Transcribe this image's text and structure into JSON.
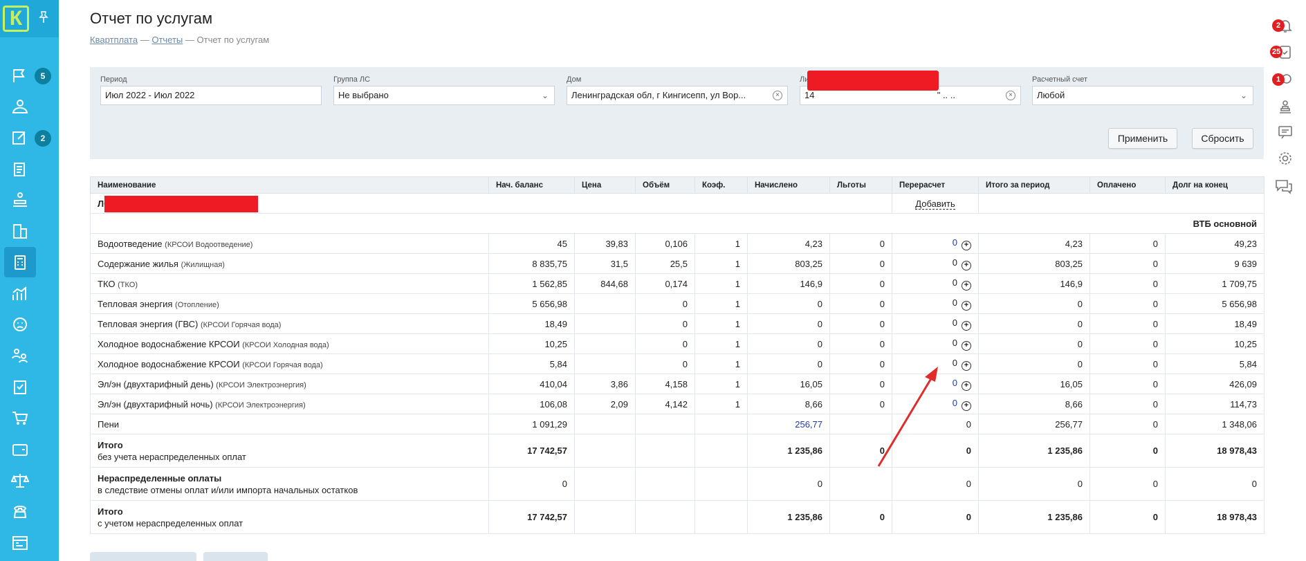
{
  "header": {
    "title": "Отчет по услугам",
    "breadcrumb": [
      "Квартплата",
      "Отчеты",
      "Отчет по услугам"
    ],
    "separator": "—"
  },
  "sidebar": {
    "logo": "К",
    "items": [
      {
        "icon": "flag-icon",
        "badge": "5"
      },
      {
        "icon": "users-group-icon"
      },
      {
        "icon": "edit-document-icon",
        "badge": "2"
      },
      {
        "icon": "documents-icon"
      },
      {
        "icon": "desk-icon"
      },
      {
        "icon": "building-icon"
      },
      {
        "icon": "calculator-icon",
        "active": true
      },
      {
        "icon": "chart-icon"
      },
      {
        "icon": "face-icon"
      },
      {
        "icon": "team-icon"
      },
      {
        "icon": "checklist-icon"
      },
      {
        "icon": "cart-icon"
      },
      {
        "icon": "wallet-icon"
      },
      {
        "icon": "scales-icon"
      },
      {
        "icon": "phone-icon"
      },
      {
        "icon": "calendar-icon"
      }
    ]
  },
  "rail": {
    "notifications_badge": "2",
    "tasks_badge": "25",
    "requests_badge": "1"
  },
  "filters": {
    "period": {
      "label": "Период",
      "value": "Июл 2022 - Июл 2022"
    },
    "group": {
      "label": "Группа ЛС",
      "value": "Не выбрано"
    },
    "house": {
      "label": "Дом",
      "value": "Ленинградская обл, г Кингисепп, ул Вор..."
    },
    "account": {
      "label": "Лицевой счет",
      "value_prefix": "14",
      "value_suffix": "\" .. .."
    },
    "settlement": {
      "label": "Расчетный счет",
      "value": "Любой"
    },
    "apply_label": "Применить",
    "reset_label": "Сбросить"
  },
  "table": {
    "columns": [
      "Наименование",
      "Нач. баланс",
      "Цена",
      "Объём",
      "Коэф.",
      "Начислено",
      "Льготы",
      "Перерасчет",
      "Итого за период",
      "Оплачено",
      "Долг на конец"
    ],
    "account_row": {
      "prefix": "ЛС",
      "add_label": "Добавить"
    },
    "section_title": "ВТБ основной",
    "rows": [
      {
        "name": "Водоотведение",
        "sub": "(КРСОИ Водоотведение)",
        "start": "45",
        "price": "39,83",
        "volume": "0,106",
        "coef": "1",
        "charged": "4,23",
        "benefits": "0",
        "recalc": "0",
        "recalc_blue": true,
        "total": "4,23",
        "paid": "0",
        "debt": "49,23"
      },
      {
        "name": "Содержание жилья",
        "sub": "(Жилищная)",
        "start": "8 835,75",
        "price": "31,5",
        "volume": "25,5",
        "coef": "1",
        "charged": "803,25",
        "benefits": "0",
        "recalc": "0",
        "recalc_blue": false,
        "total": "803,25",
        "paid": "0",
        "debt": "9 639"
      },
      {
        "name": "ТКО",
        "sub": "(ТКО)",
        "start": "1 562,85",
        "price": "844,68",
        "volume": "0,174",
        "coef": "1",
        "charged": "146,9",
        "benefits": "0",
        "recalc": "0",
        "recalc_blue": false,
        "total": "146,9",
        "paid": "0",
        "debt": "1 709,75"
      },
      {
        "name": "Тепловая энергия",
        "sub": "(Отопление)",
        "start": "5 656,98",
        "price": "",
        "volume": "0",
        "coef": "1",
        "charged": "0",
        "benefits": "0",
        "recalc": "0",
        "recalc_blue": false,
        "total": "0",
        "paid": "0",
        "debt": "5 656,98"
      },
      {
        "name": "Тепловая энергия (ГВС)",
        "sub": "(КРСОИ Горячая вода)",
        "start": "18,49",
        "price": "",
        "volume": "0",
        "coef": "1",
        "charged": "0",
        "benefits": "0",
        "recalc": "0",
        "recalc_blue": false,
        "total": "0",
        "paid": "0",
        "debt": "18,49"
      },
      {
        "name": "Холодное водоснабжение КРСОИ",
        "sub": "(КРСОИ Холодная вода)",
        "start": "10,25",
        "price": "",
        "volume": "0",
        "coef": "1",
        "charged": "0",
        "benefits": "0",
        "recalc": "0",
        "recalc_blue": false,
        "total": "0",
        "paid": "0",
        "debt": "10,25"
      },
      {
        "name": "Холодное водоснабжение КРСОИ",
        "sub": "(КРСОИ Горячая вода)",
        "start": "5,84",
        "price": "",
        "volume": "0",
        "coef": "1",
        "charged": "0",
        "benefits": "0",
        "recalc": "0",
        "recalc_blue": false,
        "total": "0",
        "paid": "0",
        "debt": "5,84"
      },
      {
        "name": "Эл/эн (двухтарифный день)",
        "sub": "(КРСОИ Электроэнергия)",
        "start": "410,04",
        "price": "3,86",
        "volume": "4,158",
        "coef": "1",
        "charged": "16,05",
        "benefits": "0",
        "recalc": "0",
        "recalc_blue": true,
        "total": "16,05",
        "paid": "0",
        "debt": "426,09"
      },
      {
        "name": "Эл/эн (двухтарифный ночь)",
        "sub": "(КРСОИ Электроэнергия)",
        "start": "106,08",
        "price": "2,09",
        "volume": "4,142",
        "coef": "1",
        "charged": "8,66",
        "benefits": "0",
        "recalc": "0",
        "recalc_blue": true,
        "total": "8,66",
        "paid": "0",
        "debt": "114,73"
      }
    ],
    "penalty": {
      "name": "Пени",
      "start": "1 091,29",
      "charged": "256,77",
      "recalc": "0",
      "total": "256,77",
      "paid": "0",
      "debt": "1 348,06"
    },
    "total1": {
      "title": "Итого",
      "subtitle": "без учета нераспределенных оплат",
      "start": "17 742,57",
      "charged": "1 235,86",
      "benefits": "0",
      "recalc": "0",
      "total": "1 235,86",
      "paid": "0",
      "debt": "18 978,43"
    },
    "unallocated": {
      "title": "Нераспределенные оплаты",
      "subtitle": "в следствие отмены оплат и/или импорта начальных остатков",
      "start": "0",
      "charged": "0",
      "recalc": "0",
      "total": "0",
      "paid": "0",
      "debt": "0"
    },
    "total2": {
      "title": "Итого",
      "subtitle": "с учетом нераспределенных оплат",
      "start": "17 742,57",
      "charged": "1 235,86",
      "benefits": "0",
      "recalc": "0",
      "total": "1 235,86",
      "paid": "0",
      "debt": "18 978,43"
    }
  }
}
